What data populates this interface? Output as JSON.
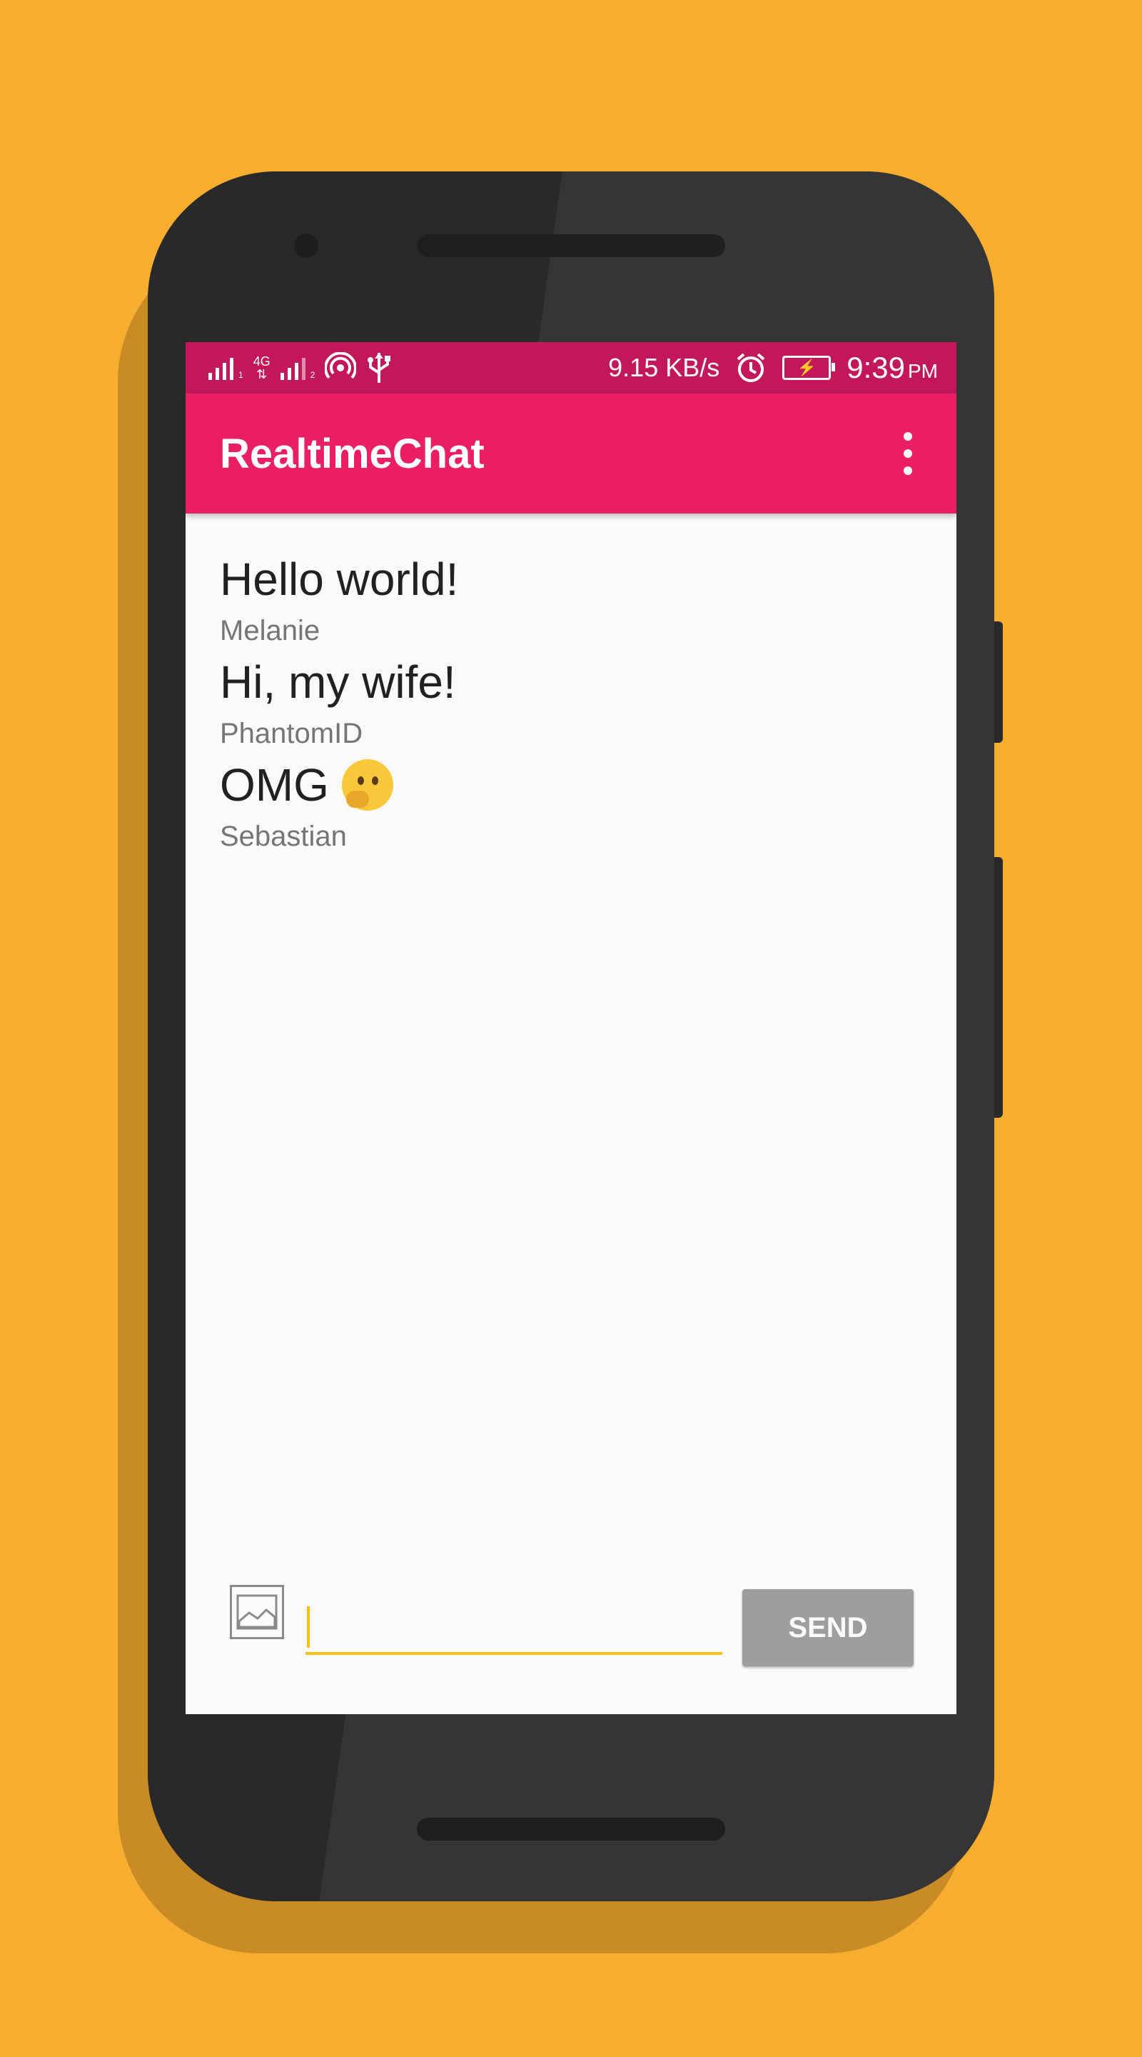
{
  "status_bar": {
    "sim1_index": "1",
    "network_type": "4G",
    "sim2_index": "2",
    "speed": "9.15 KB/s",
    "time": "9:39",
    "ampm": "PM"
  },
  "app_bar": {
    "title": "RealtimeChat"
  },
  "messages": [
    {
      "text": "Hello world!",
      "author": "Melanie"
    },
    {
      "text": "Hi, my wife!",
      "author": "PhantomID"
    },
    {
      "text": "OMG",
      "author": "Sebastian",
      "emoji": "thinking-face"
    }
  ],
  "composer": {
    "input_value": "",
    "send_label": "SEND"
  },
  "colors": {
    "background": "#f7ae2e",
    "status_bar": "#c2185b",
    "app_bar": "#e91e63",
    "input_underline": "#f4c013",
    "send_button": "#9e9e9e"
  }
}
